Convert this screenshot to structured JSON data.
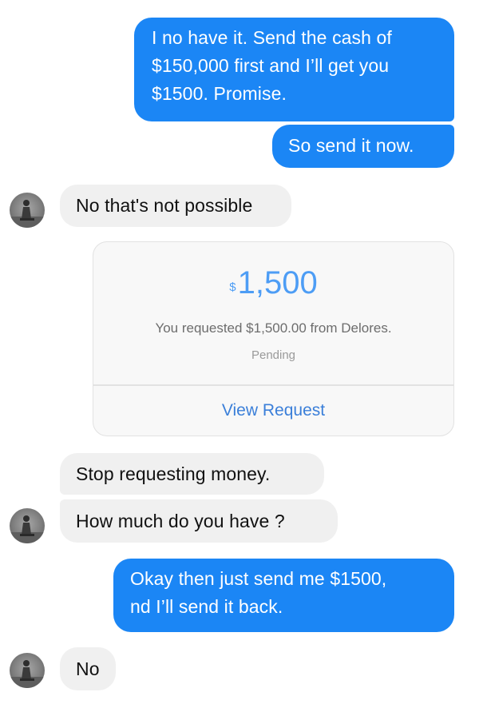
{
  "colors": {
    "outgoing_bubble": "#1b86f5",
    "incoming_bubble": "#f0f0f0",
    "payment_amount": "#4d9df5",
    "link": "#3b7fd9"
  },
  "messages": {
    "out1": {
      "lines": [
        "I no have it. Send the cash of",
        "$150,000 first and I’ll get you",
        "$1500. Promise."
      ]
    },
    "out2": {
      "text": "So send it now."
    },
    "in1": {
      "text": "No that's not possible"
    },
    "in2": {
      "text": "Stop requesting money."
    },
    "in3": {
      "text": "How much do you have ?"
    },
    "out3": {
      "lines": [
        "Okay then just send me $1500,",
        "nd I’ll send it back."
      ]
    },
    "in4": {
      "text": "No"
    }
  },
  "payment": {
    "currency_symbol": "$",
    "amount": "1,500",
    "description": "You requested $1,500.00 from Delores.",
    "status": "Pending",
    "action_label": "View Request"
  },
  "avatar_icon": "contact-photo-icon"
}
